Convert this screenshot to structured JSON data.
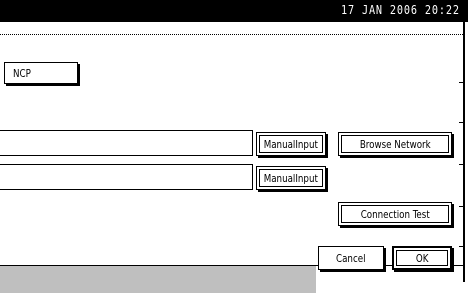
{
  "status": {
    "datetime": "17 JAN  2006 20:22"
  },
  "protocol": {
    "selected": "NCP"
  },
  "row1": {
    "manual_input": "ManualInput",
    "browse_network": "Browse Network"
  },
  "row2": {
    "manual_input": "ManualInput"
  },
  "actions": {
    "connection_test": "Connection Test",
    "cancel": "Cancel",
    "ok": "OK"
  }
}
